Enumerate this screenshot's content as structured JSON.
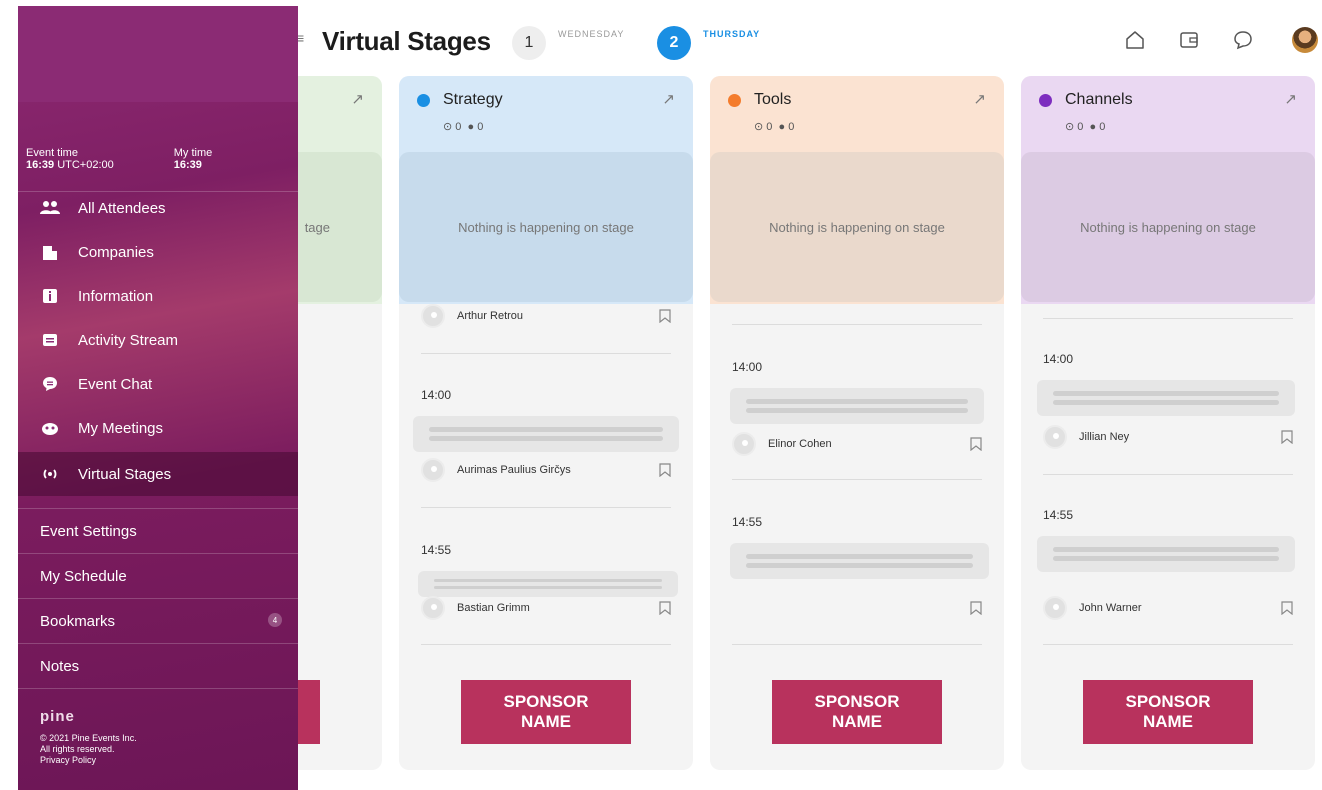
{
  "header": {
    "title": "Virtual Stages",
    "days": [
      {
        "num": "1",
        "label": "WEDNESDAY"
      },
      {
        "num": "2",
        "label": "THURSDAY"
      }
    ]
  },
  "sidebar": {
    "event_time_label": "Event time",
    "event_time_value": "16:39",
    "event_time_zone": "UTC+02:00",
    "my_time_label": "My time",
    "my_time_value": "16:39",
    "items": [
      {
        "label": "All Attendees"
      },
      {
        "label": "Companies"
      },
      {
        "label": "Information"
      },
      {
        "label": "Activity Stream"
      },
      {
        "label": "Event Chat"
      },
      {
        "label": "My Meetings"
      },
      {
        "label": "Virtual Stages"
      }
    ],
    "secondary": [
      {
        "label": "Event Settings"
      },
      {
        "label": "My Schedule"
      },
      {
        "label": "Bookmarks",
        "badge": "4"
      },
      {
        "label": "Notes"
      }
    ],
    "logo": "pine",
    "copyright": "© 2021 Pine Events Inc.",
    "rights": "All rights reserved.",
    "privacy": "Privacy Policy"
  },
  "stages": {
    "first_partial_text": "tage",
    "strategy": {
      "name": "Strategy",
      "color": "#1a8fe3",
      "eye_count": "0",
      "chat_count": "0",
      "stage_text": "Nothing is happening on stage",
      "speaker1": "Arthur Retrou",
      "time1": "14:00",
      "speaker2": "Aurimas Paulius Girčys",
      "time2": "14:55",
      "speaker3": "Bastian Grimm",
      "sponsor": "SPONSOR NAME"
    },
    "tools": {
      "name": "Tools",
      "color": "#f47c2c",
      "eye_count": "0",
      "chat_count": "0",
      "stage_text": "Nothing is happening on stage",
      "time1": "14:00",
      "speaker1": "Elinor Cohen",
      "time2": "14:55",
      "sponsor": "SPONSOR NAME"
    },
    "channels": {
      "name": "Channels",
      "color": "#7d2dbf",
      "eye_count": "0",
      "chat_count": "0",
      "stage_text": "Nothing is happening on stage",
      "time1": "14:00",
      "speaker1": "Jillian Ney",
      "time2": "14:55",
      "speaker2": "John Warner",
      "sponsor": "SPONSOR NAME"
    }
  },
  "colors": {
    "strategy_bg": "#d6e8f8",
    "tools_bg": "#fbe3d2",
    "channels_bg": "#ead8f2",
    "sponsor": "#b8325d",
    "accent": "#1a8fe3"
  }
}
